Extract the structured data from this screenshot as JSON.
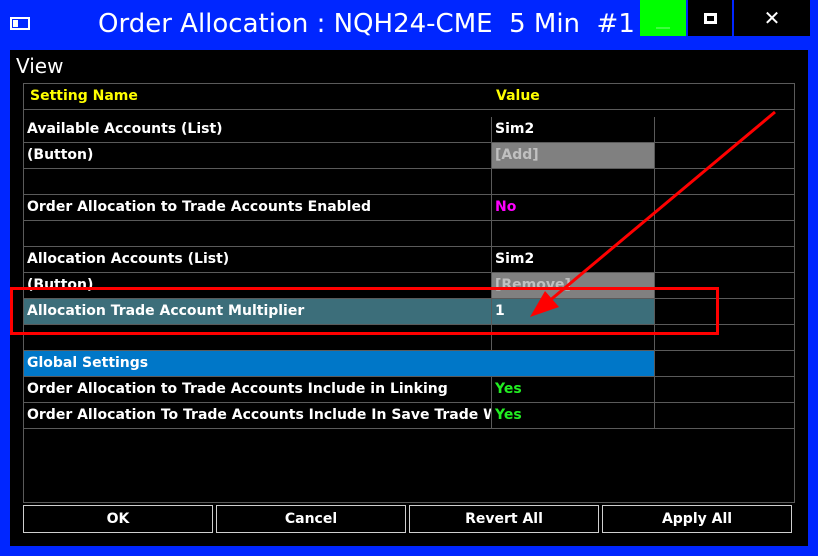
{
  "window": {
    "title": "Order Allocation : NQH24-CME  5 Min  #1",
    "close_glyph": "✕"
  },
  "view_label": "View",
  "grid": {
    "header": {
      "name": "Setting Name",
      "value": "Value"
    },
    "rows": [
      {
        "name": "Available Accounts (List)",
        "value": "Sim2"
      },
      {
        "name": " (Button)",
        "value": "[Add]"
      },
      {
        "name": "",
        "value": ""
      },
      {
        "name": "Order Allocation to Trade Accounts Enabled",
        "value": "No"
      },
      {
        "name": "",
        "value": ""
      },
      {
        "name": "Allocation Accounts (List)",
        "value": "Sim2"
      },
      {
        "name": " (Button)",
        "value": "[Remove]"
      },
      {
        "name": "Allocation Trade Account Multiplier",
        "value": "1"
      },
      {
        "name": "",
        "value": ""
      },
      {
        "name": "Global Settings",
        "value": ""
      },
      {
        "name": "Order Allocation to Trade Accounts Include in Linking",
        "value": "Yes"
      },
      {
        "name": "Order Allocation To Trade Accounts Include In Save Trade Window",
        "value": "Yes"
      }
    ]
  },
  "footer": {
    "ok": "OK",
    "cancel": "Cancel",
    "revert_all": "Revert All",
    "apply_all": "Apply All"
  },
  "colors": {
    "title_bar": "#0026ff",
    "header_text": "#ffff00",
    "selected_row": "#3c6e7a",
    "global_row": "#0077c8",
    "yes": "#22ee22",
    "no": "#ff00ff",
    "annotation": "#ff0000"
  }
}
